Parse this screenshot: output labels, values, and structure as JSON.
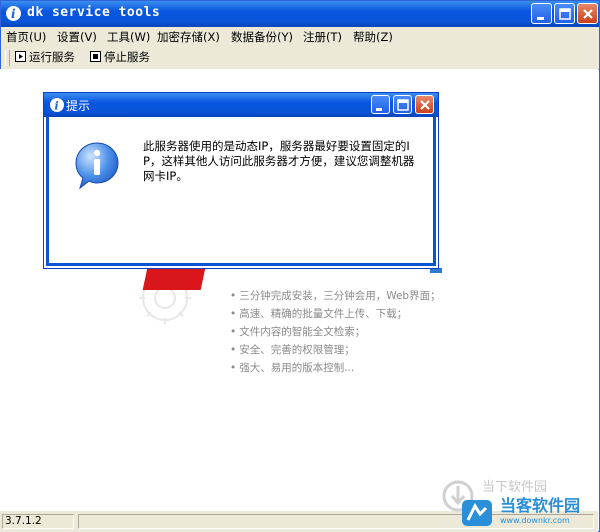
{
  "window": {
    "title": "dk service tools"
  },
  "menu": [
    {
      "label": "首页(U)"
    },
    {
      "label": "设置(V)"
    },
    {
      "label": "工具(W)"
    },
    {
      "label": "加密存储(X)"
    },
    {
      "label": "数据备份(Y)"
    },
    {
      "label": "注册(T)"
    },
    {
      "label": "帮助(Z)"
    }
  ],
  "toolbar": {
    "run_label": "运行服务",
    "stop_label": "停止服务"
  },
  "features": [
    "三分钟完成安装，三分钟会用，Web界面；",
    "高速、精确的批量文件上传、下载；",
    "文件内容的智能全文检索；",
    "安全、完善的权限管理；",
    "强大、易用的版本控制..."
  ],
  "dialog": {
    "title": "提示",
    "message": "此服务器使用的是动态IP，服务器最好要设置固定的IP，这样其他人访问此服务器才方便，建议您调整机器网卡IP。"
  },
  "status": {
    "version": "3.7.1.2"
  },
  "watermark": {
    "brand": "当客软件园",
    "url": "www.downkr.com",
    "faded": "当下软件园"
  },
  "colors": {
    "titlebar": "#0a54d8",
    "accent_red": "#d9161b",
    "accent_blue": "#2e7bcf"
  }
}
